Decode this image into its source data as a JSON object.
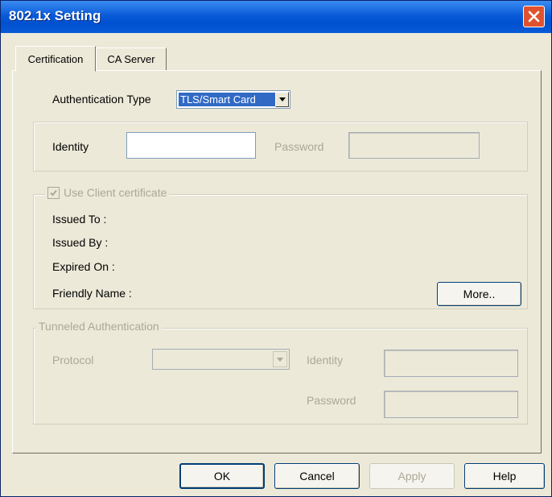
{
  "window": {
    "title": "802.1x Setting"
  },
  "tabs": [
    {
      "label": "Certification",
      "active": true
    },
    {
      "label": "CA Server",
      "active": false
    }
  ],
  "certification": {
    "auth_type_label": "Authentication Type",
    "auth_type_value": "TLS/Smart Card",
    "identity_label": "Identity",
    "identity_value": "",
    "password_label": "Password",
    "password_value": "",
    "client_cert": {
      "checkbox_label": "Use Client certificate",
      "checked": true,
      "issued_to_label": "Issued To :",
      "issued_by_label": "Issued By :",
      "expired_on_label": "Expired On :",
      "friendly_name_label": "Friendly Name :",
      "more_button": "More.."
    },
    "tunneled": {
      "legend": "Tunneled Authentication",
      "protocol_label": "Protocol",
      "protocol_value": "",
      "identity_label": "Identity",
      "identity_value": "",
      "password_label": "Password",
      "password_value": ""
    }
  },
  "buttons": {
    "ok": "OK",
    "cancel": "Cancel",
    "apply": "Apply",
    "help": "Help"
  },
  "colors": {
    "titlebar": "#0A5BD8",
    "face": "#ECE9D8",
    "selection": "#316AC5",
    "close": "#E0522E"
  }
}
